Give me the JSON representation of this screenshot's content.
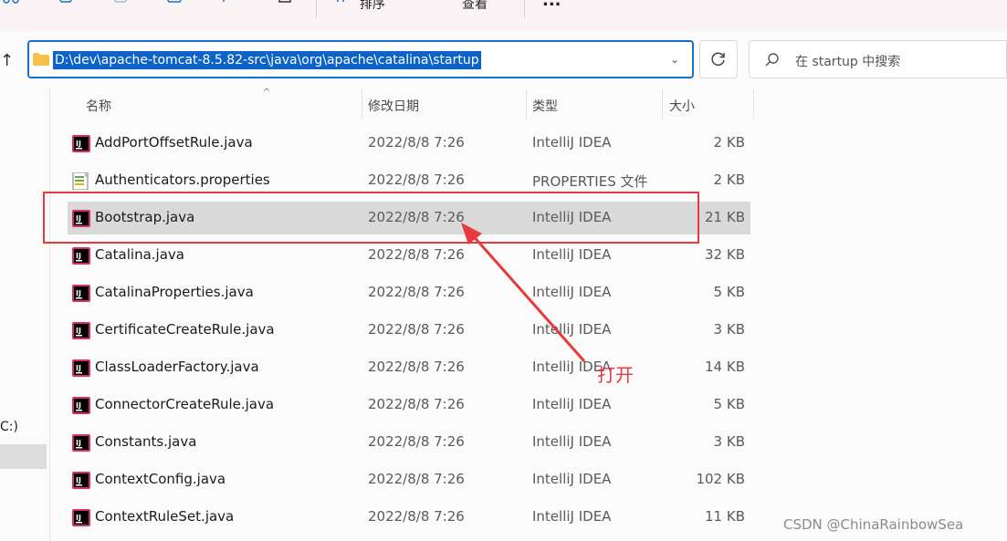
{
  "toolbar": {
    "sort_label": "排序",
    "view_label": "查看",
    "more_label": "..."
  },
  "address": {
    "path": "D:\\dev\\apache-tomcat-8.5.82-src\\java\\org\\apache\\catalina\\startup"
  },
  "search": {
    "placeholder": "在 startup 中搜索"
  },
  "nav": {
    "drive_label": "C:)"
  },
  "columns": {
    "name": "名称",
    "date": "修改日期",
    "type": "类型",
    "size": "大小"
  },
  "files": [
    {
      "name": "AddPortOffsetRule.java",
      "date": "2022/8/8 7:26",
      "type": "IntelliJ IDEA",
      "size": "2 KB",
      "icon": "intellij-icon"
    },
    {
      "name": "Authenticators.properties",
      "date": "2022/8/8 7:26",
      "type": "PROPERTIES 文件",
      "size": "2 KB",
      "icon": "properties-file-icon"
    },
    {
      "name": "Bootstrap.java",
      "date": "2022/8/8 7:26",
      "type": "IntelliJ IDEA",
      "size": "21 KB",
      "icon": "intellij-icon",
      "selected": true
    },
    {
      "name": "Catalina.java",
      "date": "2022/8/8 7:26",
      "type": "IntelliJ IDEA",
      "size": "32 KB",
      "icon": "intellij-icon"
    },
    {
      "name": "CatalinaProperties.java",
      "date": "2022/8/8 7:26",
      "type": "IntelliJ IDEA",
      "size": "5 KB",
      "icon": "intellij-icon"
    },
    {
      "name": "CertificateCreateRule.java",
      "date": "2022/8/8 7:26",
      "type": "IntelliJ IDEA",
      "size": "3 KB",
      "icon": "intellij-icon"
    },
    {
      "name": "ClassLoaderFactory.java",
      "date": "2022/8/8 7:26",
      "type": "IntelliJ IDEA",
      "size": "14 KB",
      "icon": "intellij-icon"
    },
    {
      "name": "ConnectorCreateRule.java",
      "date": "2022/8/8 7:26",
      "type": "IntelliJ IDEA",
      "size": "5 KB",
      "icon": "intellij-icon"
    },
    {
      "name": "Constants.java",
      "date": "2022/8/8 7:26",
      "type": "IntelliJ IDEA",
      "size": "3 KB",
      "icon": "intellij-icon"
    },
    {
      "name": "ContextConfig.java",
      "date": "2022/8/8 7:26",
      "type": "IntelliJ IDEA",
      "size": "102 KB",
      "icon": "intellij-icon"
    },
    {
      "name": "ContextRuleSet.java",
      "date": "2022/8/8 7:26",
      "type": "IntelliJ IDEA",
      "size": "11 KB",
      "icon": "intellij-icon"
    }
  ],
  "annotation": {
    "text": "打开",
    "color": "#e8393c"
  },
  "watermark": "CSDN @ChinaRainbowSea",
  "colors": {
    "selection_row": "#d9d9d9",
    "address_highlight": "#0d63c8",
    "address_border": "#1a6fc9"
  }
}
